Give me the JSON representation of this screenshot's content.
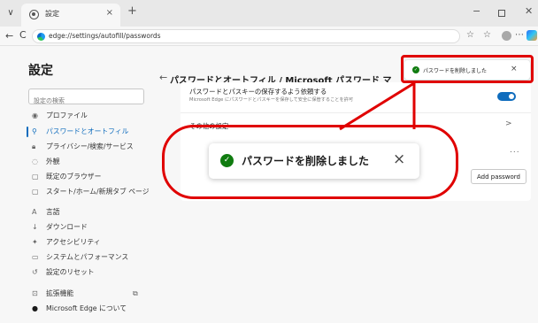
{
  "browser": {
    "tab_title": "設定",
    "tab_close": "×",
    "new_tab": "+",
    "tab_menu": "∨",
    "address": "edge://settings/autofill/passwords",
    "window": {
      "minimize": "−",
      "close": "✕"
    },
    "nav": {
      "back": "←",
      "refresh": "C"
    }
  },
  "sidebar": {
    "title": "設定",
    "search_placeholder": "設定の検索",
    "items": [
      {
        "icon": "profile-icon",
        "glyph": "◉",
        "label": "プロファイル"
      },
      {
        "icon": "key-icon",
        "glyph": "⚲",
        "label": "パスワードとオートフィル",
        "active": true
      },
      {
        "icon": "lock-icon",
        "glyph": "🔒︎",
        "label": "プライバシー/検索/サービス"
      },
      {
        "icon": "appearance-icon",
        "glyph": "◌",
        "label": "外観"
      },
      {
        "icon": "browser-icon",
        "glyph": "▢",
        "label": "既定のブラウザー"
      },
      {
        "icon": "home-icon",
        "glyph": "▢",
        "label": "スタート/ホーム/新規タブ ページ"
      },
      {
        "icon": "language-icon",
        "glyph": "A",
        "label": "言語"
      },
      {
        "icon": "download-icon",
        "glyph": "↓",
        "label": "ダウンロード"
      },
      {
        "icon": "accessibility-icon",
        "glyph": "✦",
        "label": "アクセシビリティ"
      },
      {
        "icon": "system-icon",
        "glyph": "▭",
        "label": "システムとパフォーマンス"
      },
      {
        "icon": "reset-icon",
        "glyph": "↺",
        "label": "設定のリセット"
      },
      {
        "icon": "extensions-icon",
        "glyph": "⊡",
        "label": "拡張機能"
      },
      {
        "icon": "edge-icon",
        "glyph": "●",
        "label": "Microsoft Edge について"
      }
    ]
  },
  "main": {
    "back": "←",
    "header": "パスワードとオートフィル / Microsoft パスワード マ",
    "offer_save_title": "パスワードとパスキーの保存するよう依頼する",
    "offer_save_desc": "Microsoft Edge にパスワードとパスキーを保存して安全に保管することを許可",
    "offer_save_enabled": true,
    "other_settings": "その他の設定",
    "chevron": ">",
    "more": "...",
    "add_password": "Add password"
  },
  "toast": {
    "message": "パスワードを削除しました",
    "close": "×",
    "check": "✓"
  },
  "colors": {
    "accent": "#0f6cbd",
    "success": "#107c10",
    "annotation": "#e00000"
  }
}
